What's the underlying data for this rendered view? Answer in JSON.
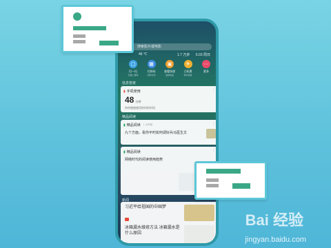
{
  "search": {
    "placeholder": "搜索影片或电影"
  },
  "weather": {
    "temp": "46 ℃",
    "steps": "1.7 万步",
    "date": "6.03 周日"
  },
  "shortcuts": [
    {
      "label": "扫一扫",
      "sub": "扫描二维码",
      "icon": "scan-icon",
      "color": "#3fa4e5"
    },
    {
      "label": "付款码",
      "sub": "扫码付款",
      "icon": "qr-icon",
      "color": "#3f8ee5"
    },
    {
      "label": "查看快递",
      "sub": "追踪快递",
      "icon": "package-icon",
      "color": "#f0a030"
    },
    {
      "label": "订机票",
      "sub": "特价机票",
      "icon": "plane-icon",
      "color": "#f0b030"
    },
    {
      "label": "更多",
      "sub": "",
      "icon": "more-icon",
      "color": "#e94b6b"
    }
  ],
  "sections": {
    "info": "信息管家",
    "reading": "精品阅读",
    "news": "新闻"
  },
  "phone_card": {
    "title": "手机使用",
    "value": "48",
    "unit": "分钟",
    "desc": "你你使使使用的时的时间"
  },
  "reading_cards": [
    {
      "title": "精品阅读",
      "time": "1 小时前",
      "body": "九个方面，看你平时如何调好兵马医生文"
    },
    {
      "title": "精品阅读",
      "time": "",
      "body": "网络时代的阅读使用趋势"
    }
  ],
  "news": [
    {
      "title": "习近平给祖国的中国梦",
      "meta": ""
    },
    {
      "title": "冰箱漏水维修方法 冰箱漏水是什么原因",
      "meta": ""
    }
  ],
  "watermark": {
    "brand": "Bai 经验",
    "url": "jingyan.baidu.com"
  },
  "colors": {
    "accent": "#5cc7d8",
    "green": "#3aa886",
    "gray": "#a8a8a8"
  }
}
